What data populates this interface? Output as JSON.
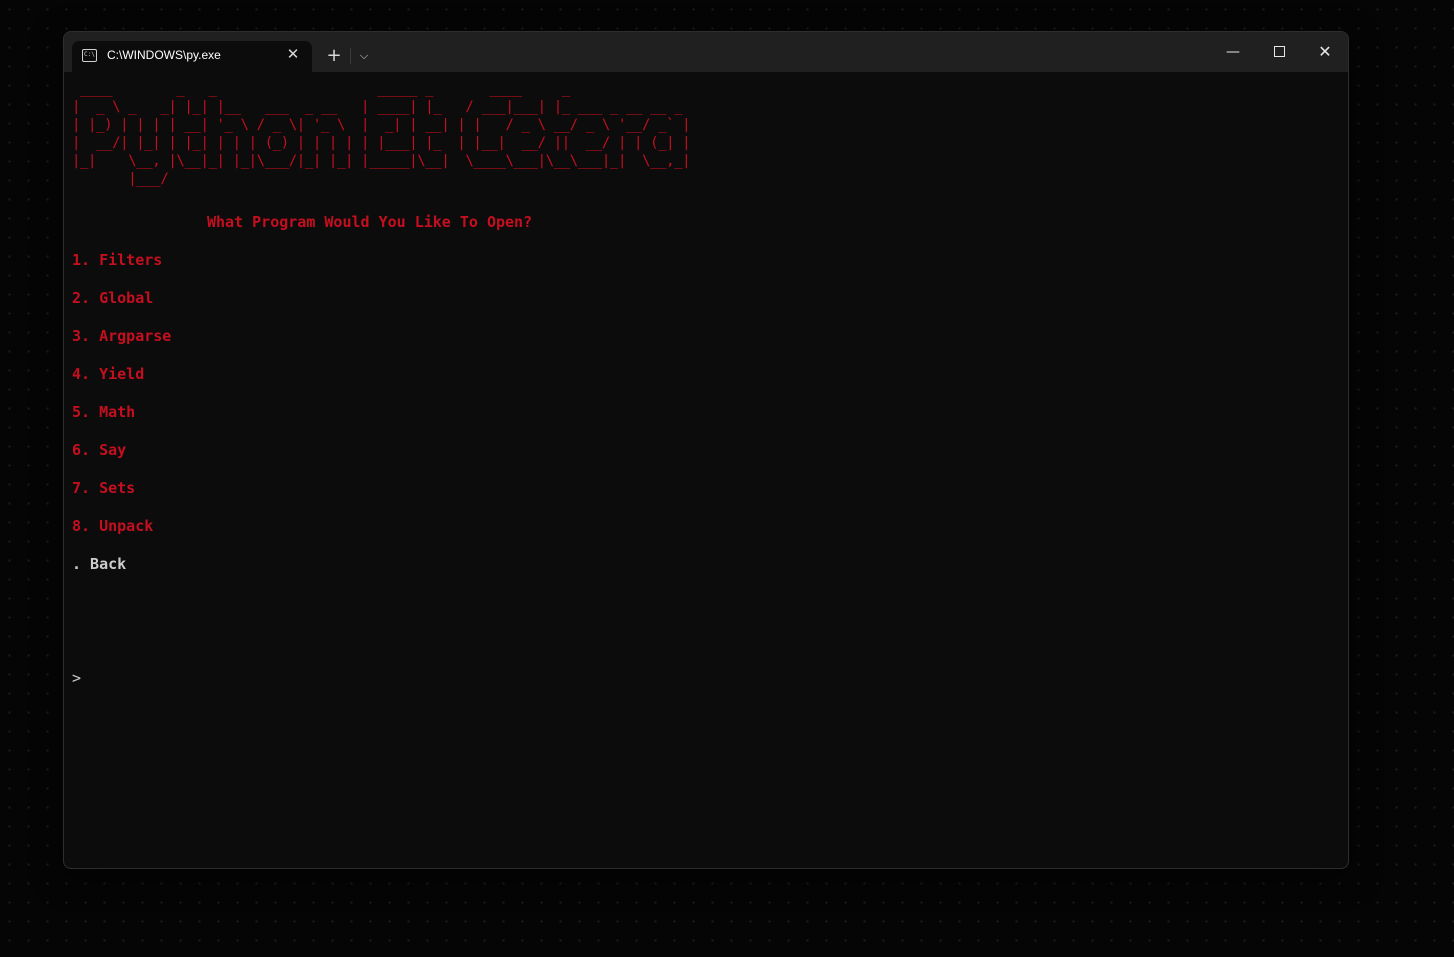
{
  "window": {
    "tab_title": "C:\\WINDOWS\\py.exe",
    "tab_icon": "terminal-icon",
    "new_tab_label": "+",
    "dropdown_label": "⌵",
    "minimize_label": "—",
    "close_label": "✕",
    "tab_close_label": "✕"
  },
  "terminal": {
    "banner": " ____        _   _                    _____ _       ____     _                \n|  _ \\ _   _| |_| |__   ___  _ __   | ____| |_   / ___|___| |_ ___ _ __ __ _ \n| |_) | | | | __| '_ \\ / _ \\| '_ \\  |  _| | __| | |   / _ \\ __/ _ \\ '__/ _` |\n|  __/| |_| | |_| | | | (_) | | | | | |___| |_  | |__|  __/ ||  __/ | | (_| |\n|_|    \\__, |\\__|_| |_|\\___/|_| |_| |_____|\\__|  \\____\\___|\\__\\___|_|  \\__,_|\n       |___/",
    "heading": "What Program Would You Like To Open?",
    "menu": [
      "1. Filters",
      "2. Global",
      "3. Argparse",
      "4. Yield",
      "5. Math",
      "6. Say",
      "7. Sets",
      "8. Unpack"
    ],
    "back": ". Back",
    "prompt": ">"
  },
  "colors": {
    "text_red": "#c50f1f",
    "text_default": "#cccccc",
    "terminal_bg": "#0c0c0c",
    "titlebar_bg": "#202020"
  }
}
